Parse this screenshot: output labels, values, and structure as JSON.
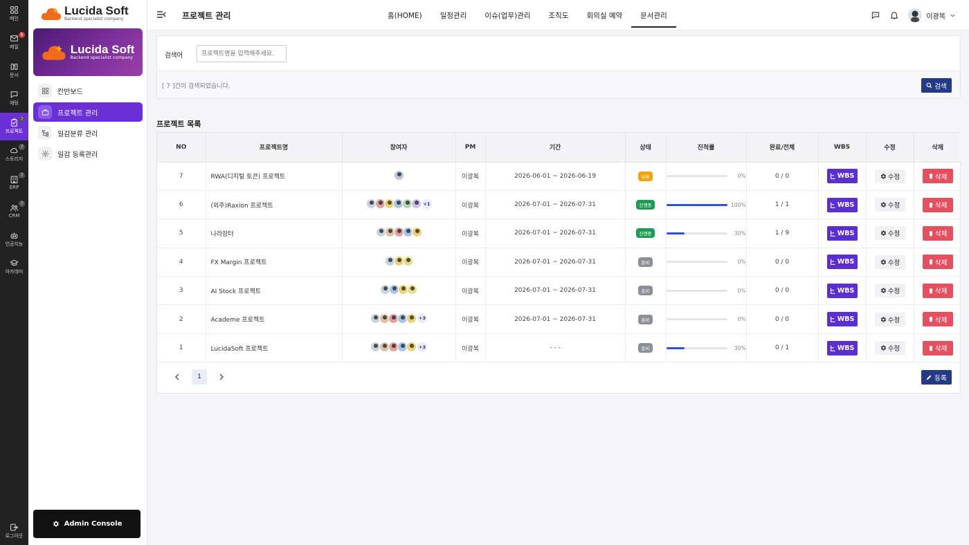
{
  "rail": {
    "items": [
      {
        "label": "메인",
        "icon": "grid-icon"
      },
      {
        "label": "메일",
        "icon": "mail-icon",
        "badge": "8"
      },
      {
        "label": "문서",
        "icon": "book-icon"
      },
      {
        "label": "채팅",
        "icon": "chat-icon"
      },
      {
        "label": "프로젝트",
        "icon": "clipboard-icon",
        "badge": "7"
      },
      {
        "label": "스토리지",
        "icon": "cloud-icon",
        "badge": "7"
      },
      {
        "label": "ERP",
        "icon": "building-icon",
        "badge": "7"
      },
      {
        "label": "CRM",
        "icon": "users-icon",
        "badge": "7"
      },
      {
        "label": "인공지능",
        "icon": "robot-icon"
      },
      {
        "label": "아카데미",
        "icon": "graduation-cap-icon"
      }
    ],
    "logout_label": "로그아웃"
  },
  "brand": {
    "name": "Lucida Soft",
    "tagline": "Backend specialist company"
  },
  "submenu": {
    "items": [
      {
        "label": "칸반보드",
        "icon": "kanban-icon"
      },
      {
        "label": "프로젝트 관리",
        "icon": "briefcase-icon"
      },
      {
        "label": "일감분류 관리",
        "icon": "tree-icon"
      },
      {
        "label": "일감 등록관리",
        "icon": "gear-icon"
      }
    ],
    "admin_label": "Admin Console"
  },
  "header": {
    "page_title": "프로젝트 관리",
    "nav": [
      "홈(HOME)",
      "일정관리",
      "이슈(업무)관리",
      "조직도",
      "회의실 예약",
      "문서관리"
    ],
    "active_nav": "문서관리",
    "user_name": "이광복"
  },
  "search": {
    "label": "검색어",
    "placeholder": "프로젝트명을 입력해주세요.",
    "result_text": "[ 7 ]건이 검색되었습니다.",
    "button_label": "검색"
  },
  "list_title": "프로젝트 목록",
  "table": {
    "columns": [
      "NO",
      "프로젝트명",
      "참여자",
      "PM",
      "기간",
      "상태",
      "진척률",
      "완료/전체",
      "WBS",
      "수정",
      "삭제"
    ],
    "wbs_label": "WBS",
    "edit_label": "수정",
    "delete_label": "삭제",
    "rows": [
      {
        "no": "7",
        "name": "RWA(디지털 토큰) 프로젝트",
        "avatars": [
          "#b9c6d6"
        ],
        "more": "",
        "pm": "이광복",
        "period": "2026-06-01 ~ 2026-06-19",
        "status": "보류",
        "status_color": "#f2a311",
        "progress": 0,
        "progress_text": "0%",
        "done": "0 / 0"
      },
      {
        "no": "6",
        "name": "(외주)Raxion 프로젝트",
        "avatars": [
          "#c7d3de",
          "#e2a0a0",
          "#e9d27a",
          "#a7c3e6",
          "#b6d3b8",
          "#c9c1e6"
        ],
        "more": "+1",
        "pm": "이광복",
        "period": "2026-07-01 ~ 2026-07-31",
        "status": "진행중",
        "status_color": "#1c9b53",
        "progress": 100,
        "progress_text": "100%",
        "done": "1 / 1"
      },
      {
        "no": "5",
        "name": "나라장터",
        "avatars": [
          "#c7d3de",
          "#d9c3a6",
          "#e2a0a0",
          "#a7c3e6",
          "#e9d27a"
        ],
        "more": "",
        "pm": "이광복",
        "period": "2026-07-01 ~ 2026-07-31",
        "status": "진행중",
        "status_color": "#1c9b53",
        "progress": 30,
        "progress_text": "30%",
        "done": "1 / 9"
      },
      {
        "no": "4",
        "name": "FX Margin 프로젝트",
        "avatars": [
          "#c7d3de",
          "#e9d27a",
          "#e8dc8a"
        ],
        "more": "",
        "pm": "이광복",
        "period": "2026-07-01 ~ 2026-07-31",
        "status": "준비",
        "status_color": "#8a8f98",
        "progress": 0,
        "progress_text": "0%",
        "done": "0 / 0"
      },
      {
        "no": "3",
        "name": "AI Stock 프로젝트",
        "avatars": [
          "#c7d3de",
          "#a7c3e6",
          "#e9d27a",
          "#e8dc8a"
        ],
        "more": "",
        "pm": "이광복",
        "period": "2026-07-01 ~ 2026-07-31",
        "status": "준비",
        "status_color": "#8a8f98",
        "progress": 0,
        "progress_text": "0%",
        "done": "0 / 0"
      },
      {
        "no": "2",
        "name": "Academe 프로젝트",
        "avatars": [
          "#c7d3de",
          "#d9c3a6",
          "#e2a0a0",
          "#a7c3e6",
          "#e9d27a"
        ],
        "more": "+3",
        "pm": "이광복",
        "period": "2026-07-01 ~ 2026-07-31",
        "status": "준비",
        "status_color": "#8a8f98",
        "progress": 0,
        "progress_text": "0%",
        "done": "0 / 0"
      },
      {
        "no": "1",
        "name": "LucidaSoft 프로젝트",
        "avatars": [
          "#c7d3de",
          "#d9c3a6",
          "#e2a0a0",
          "#a7c3e6",
          "#e9d27a"
        ],
        "more": "+3",
        "pm": "이광복",
        "period": "- - -",
        "status": "준비",
        "status_color": "#8a8f98",
        "progress": 30,
        "progress_text": "30%",
        "done": "0 / 1"
      }
    ]
  },
  "pagination": {
    "current": "1"
  },
  "register_label": "등록",
  "colors": {
    "accent": "#6b2fd6",
    "navy": "#243a84",
    "danger": "#e45060",
    "brand_orange": "#f26a1b"
  }
}
